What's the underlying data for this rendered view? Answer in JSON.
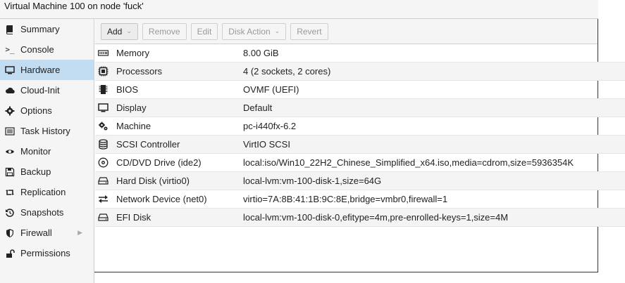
{
  "window": {
    "title": "Virtual Machine 100 on node 'fuck'"
  },
  "sidebar": {
    "items": [
      {
        "label": "Summary",
        "icon": "book-icon"
      },
      {
        "label": "Console",
        "icon": "terminal-icon"
      },
      {
        "label": "Hardware",
        "icon": "desktop-icon",
        "active": true
      },
      {
        "label": "Cloud-Init",
        "icon": "cloud-icon"
      },
      {
        "label": "Options",
        "icon": "gear-icon"
      },
      {
        "label": "Task History",
        "icon": "list-icon"
      },
      {
        "label": "Monitor",
        "icon": "eye-icon"
      },
      {
        "label": "Backup",
        "icon": "floppy-icon"
      },
      {
        "label": "Replication",
        "icon": "retweet-icon"
      },
      {
        "label": "Snapshots",
        "icon": "history-icon"
      },
      {
        "label": "Firewall",
        "icon": "shield-icon"
      },
      {
        "label": "Permissions",
        "icon": "unlock-icon"
      }
    ]
  },
  "toolbar": {
    "add": "Add",
    "remove": "Remove",
    "edit": "Edit",
    "disk_action": "Disk Action",
    "revert": "Revert"
  },
  "hardware": {
    "rows": [
      {
        "name": "Memory",
        "value": "8.00 GiB",
        "icon": "memory-icon"
      },
      {
        "name": "Processors",
        "value": "4 (2 sockets, 2 cores)",
        "icon": "cpu-icon"
      },
      {
        "name": "BIOS",
        "value": "OVMF (UEFI)",
        "icon": "microchip-icon"
      },
      {
        "name": "Display",
        "value": "Default",
        "icon": "monitor-icon"
      },
      {
        "name": "Machine",
        "value": "pc-i440fx-6.2",
        "icon": "cogs-icon"
      },
      {
        "name": "SCSI Controller",
        "value": "VirtIO SCSI",
        "icon": "database-icon"
      },
      {
        "name": "CD/DVD Drive (ide2)",
        "value": "local:iso/Win10_22H2_Chinese_Simplified_x64.iso,media=cdrom,size=5936354K",
        "icon": "cdrom-icon"
      },
      {
        "name": "Hard Disk (virtio0)",
        "value": "local-lvm:vm-100-disk-1,size=64G",
        "icon": "harddisk-icon"
      },
      {
        "name": "Network Device (net0)",
        "value": "virtio=7A:8B:41:1B:9C:8E,bridge=vmbr0,firewall=1",
        "icon": "exchange-icon"
      },
      {
        "name": "EFI Disk",
        "value": "local-lvm:vm-100-disk-0,efitype=4m,pre-enrolled-keys=1,size=4M",
        "icon": "harddisk-icon"
      }
    ]
  }
}
